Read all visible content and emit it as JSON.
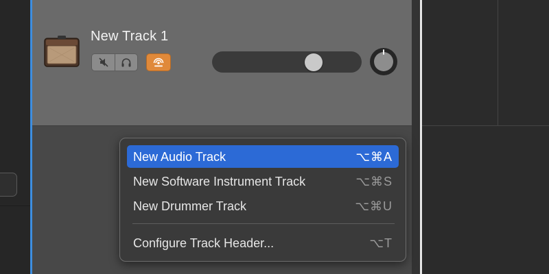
{
  "track": {
    "name": "New Track 1",
    "volume_fraction": 0.71,
    "icon": "guitar-amp-icon",
    "buttons": {
      "mute_icon": "speaker-muted-icon",
      "solo_icon": "headphones-icon",
      "record_enable_icon": "input-monitoring-icon"
    }
  },
  "context_menu": {
    "items": [
      {
        "label": "New Audio Track",
        "shortcut": "⌥⌘A",
        "selected": true
      },
      {
        "label": "New Software Instrument Track",
        "shortcut": "⌥⌘S",
        "selected": false
      },
      {
        "label": "New Drummer Track",
        "shortcut": "⌥⌘U",
        "selected": false
      },
      {
        "label": "Configure Track Header...",
        "shortcut": "⌥T",
        "selected": false
      }
    ]
  },
  "colors": {
    "selection": "#2c6ad6",
    "record_button": "#e0893a",
    "playhead_line": "#3d8ee0"
  }
}
